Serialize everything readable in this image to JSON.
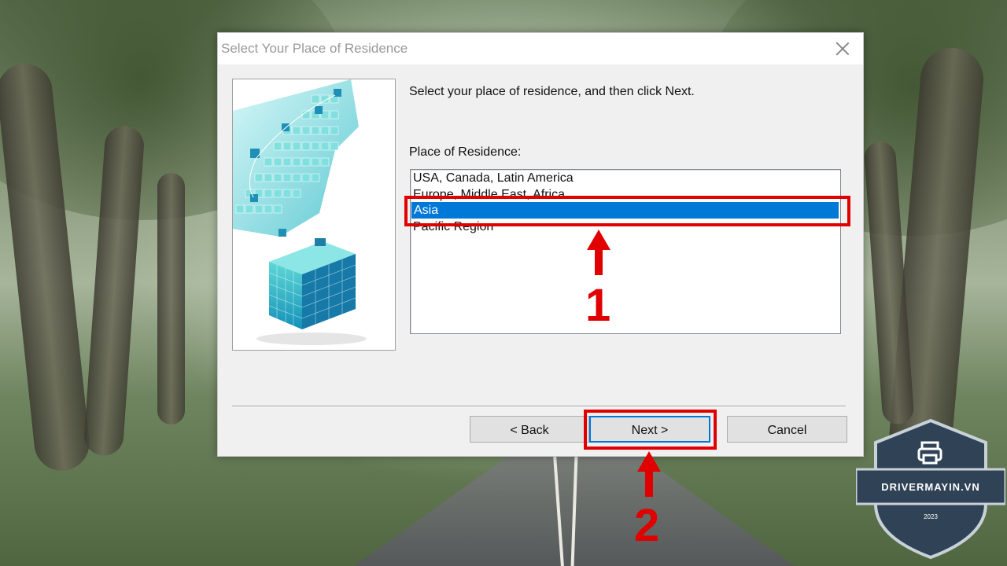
{
  "dialog": {
    "title": "Select Your Place of Residence",
    "instruction": "Select your place of residence, and then click Next.",
    "list_label": "Place of Residence:",
    "items": [
      "USA, Canada, Latin America",
      "Europe, Middle East, Africa",
      "Asia",
      "Pacific Region"
    ],
    "selected_item": "Asia",
    "buttons": {
      "back": "< Back",
      "next": "Next >",
      "cancel": "Cancel"
    }
  },
  "annotations": {
    "step1": "1",
    "step2": "2",
    "color": "#e00000"
  },
  "logo": {
    "brand": "DRIVERMAYIN.VN",
    "year": "2023",
    "icon": "printer-icon"
  },
  "colors": {
    "selection": "#0078d7",
    "image_accent": "#22c3c9"
  }
}
